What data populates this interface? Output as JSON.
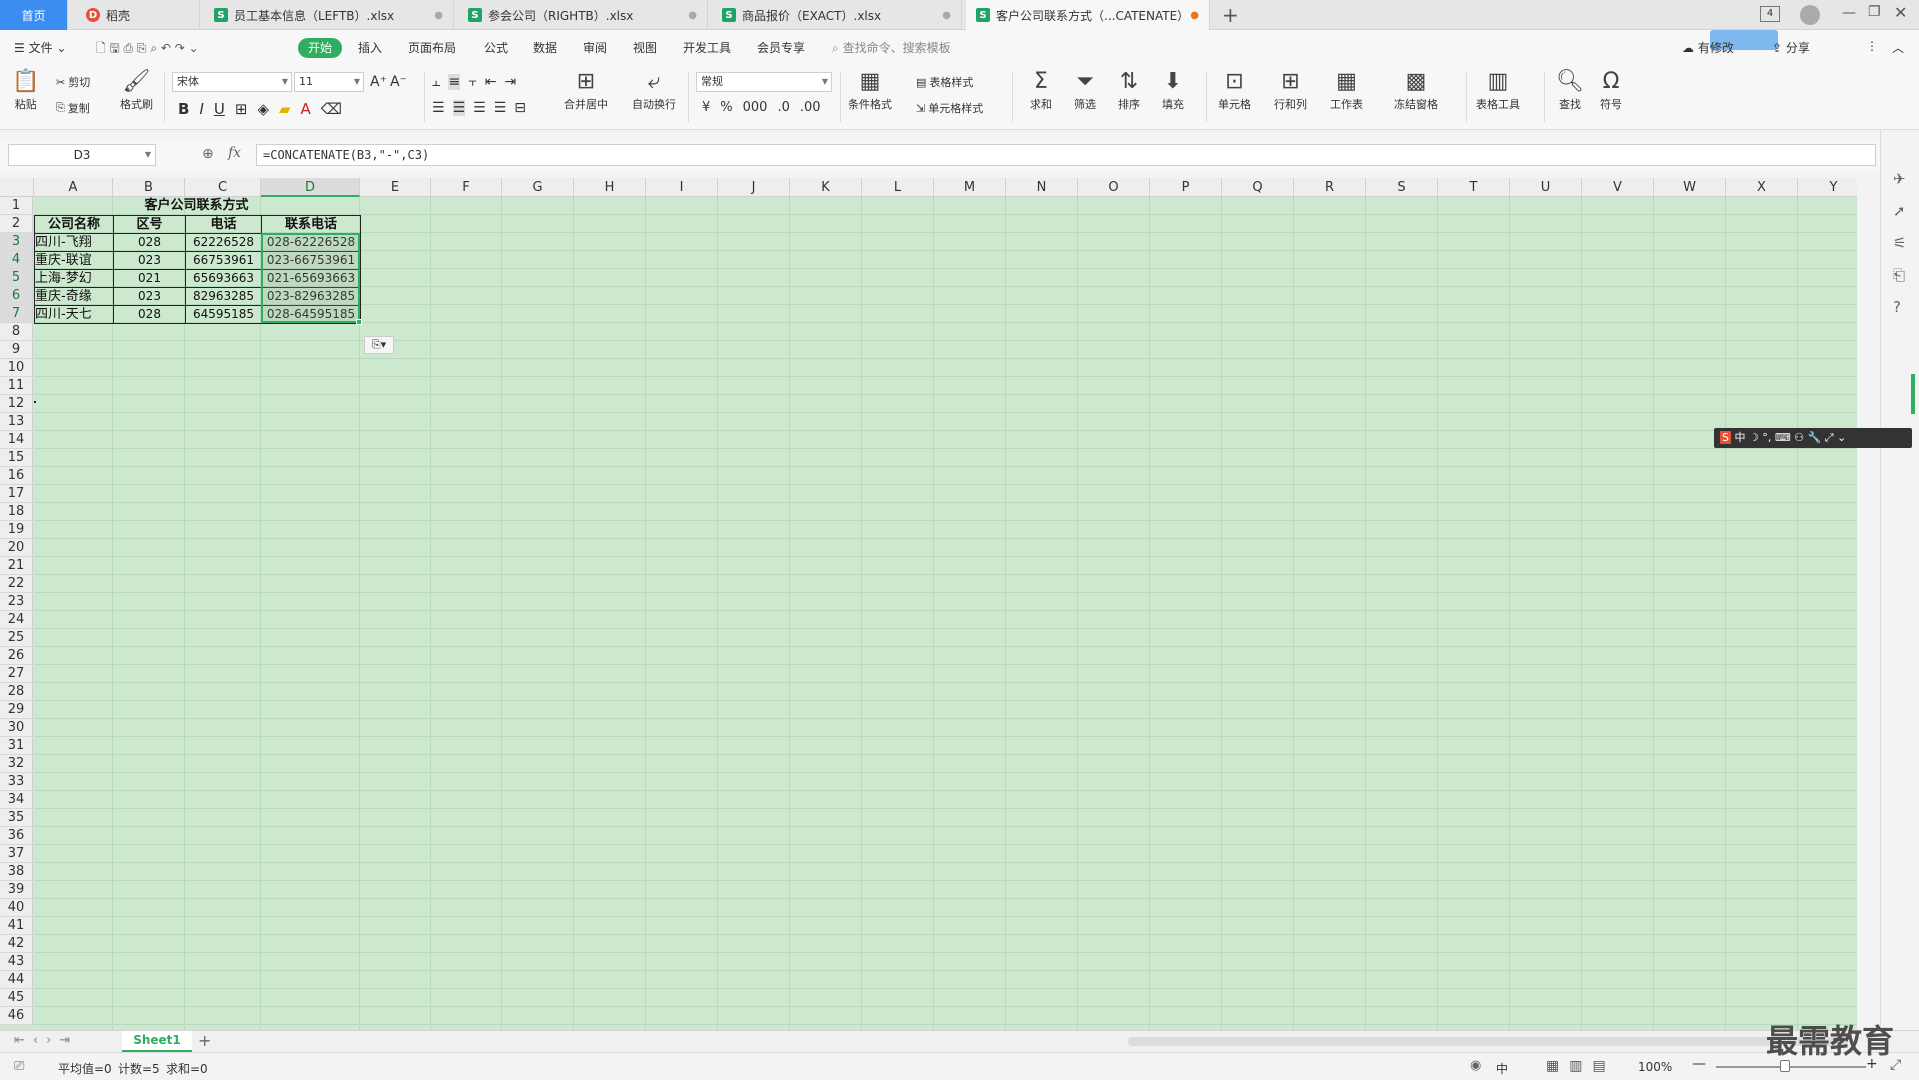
{
  "tabs": [
    {
      "label": "首页",
      "type": "home"
    },
    {
      "label": "稻壳",
      "type": "wps"
    },
    {
      "label": "员工基本信息（LEFTB）.xlsx",
      "type": "xls"
    },
    {
      "label": "参会公司（RIGHTB）.xlsx",
      "type": "xls"
    },
    {
      "label": "商品报价（EXACT）.xlsx",
      "type": "xls"
    },
    {
      "label": "客户公司联系方式（...CATENATE）",
      "type": "xls",
      "active": true
    }
  ],
  "window": {
    "tab_count": "4",
    "cloud_badge": "有修改",
    "share": "分享"
  },
  "menu": {
    "file": "文件",
    "items": [
      "开始",
      "插入",
      "页面布局",
      "公式",
      "数据",
      "审阅",
      "视图",
      "开发工具",
      "会员专享"
    ],
    "active": "开始",
    "search_placeholder": "查找命令、搜索模板"
  },
  "toolbar": {
    "paste": "粘贴",
    "cut": "剪切",
    "copy": "复制",
    "format_painter": "格式刷",
    "font_name": "宋体",
    "font_size": "11",
    "merge_center": "合并居中",
    "wrap_text": "自动换行",
    "number_format": "常规",
    "cond_format": "条件格式",
    "table_style": "表格样式",
    "cell_style": "单元格样式",
    "sum": "求和",
    "filter": "筛选",
    "sort": "排序",
    "fill": "填充",
    "cell": "单元格",
    "row_col": "行和列",
    "worksheet": "工作表",
    "freeze": "冻结窗格",
    "table_tools": "表格工具",
    "find": "查找",
    "symbol": "符号"
  },
  "formula_bar": {
    "name_box": "D3",
    "fx": "fx",
    "formula": "=CONCATENATE(B3,\"-\",C3)"
  },
  "columns": [
    "A",
    "B",
    "C",
    "D",
    "E",
    "F",
    "G",
    "H",
    "I",
    "J",
    "K",
    "L",
    "M",
    "N",
    "O",
    "P",
    "Q",
    "R",
    "S",
    "T",
    "U",
    "V",
    "W",
    "X",
    "Y"
  ],
  "rows": [
    "1",
    "2",
    "3",
    "4",
    "5",
    "6",
    "7",
    "8",
    "9",
    "10",
    "11",
    "12",
    "13",
    "14",
    "15",
    "16",
    "17",
    "18",
    "19",
    "20",
    "21",
    "22",
    "23",
    "24",
    "25",
    "26",
    "27",
    "28",
    "29",
    "30",
    "31",
    "32",
    "33",
    "34",
    "35",
    "36",
    "37",
    "38",
    "39",
    "40",
    "41",
    "42",
    "43",
    "44",
    "45",
    "46"
  ],
  "sheet": {
    "title": "客户公司联系方式",
    "headers": [
      "公司名称",
      "区号",
      "电话",
      "联系电话"
    ],
    "rows": [
      [
        "四川-飞翔",
        "028",
        "62226528",
        "028-62226528"
      ],
      [
        "重庆-联谊",
        "023",
        "66753961",
        "023-66753961"
      ],
      [
        "上海-梦幻",
        "021",
        "65693663",
        "021-65693663"
      ],
      [
        "重庆-奇缘",
        "023",
        "82963285",
        "023-82963285"
      ],
      [
        "四川-天七",
        "028",
        "64595185",
        "028-64595185"
      ]
    ]
  },
  "sheet_tabs": [
    "Sheet1"
  ],
  "status": {
    "avg": "平均值=0",
    "count": "计数=5",
    "sum": "求和=0",
    "zoom": "100%",
    "ime": "中"
  },
  "watermark": "最需教育",
  "colors": {
    "accent": "#2fae5f",
    "grid_bg": "#cce8cf",
    "tab_home": "#3c8df0"
  }
}
